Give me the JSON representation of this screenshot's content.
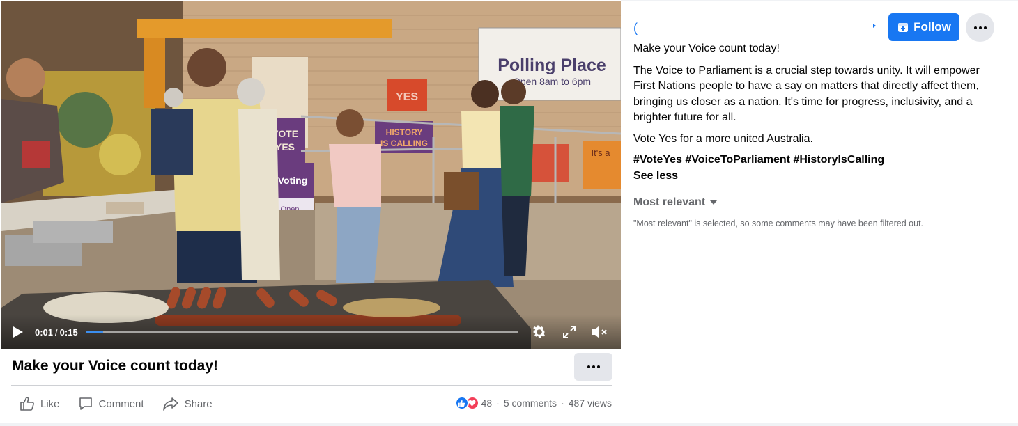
{
  "video": {
    "current_time": "0:01",
    "duration": "0:15",
    "time_separator": "/",
    "progress_fraction": 0.04,
    "scene_text": {
      "polling_title": "Polling Place",
      "polling_hours": "Open 8am to 6pm",
      "history_line1": "HISTORY",
      "history_line2": "IS CALLING",
      "yes_sign": "YES",
      "vote_sign_1": "VOTE",
      "vote_sign_2": "YES",
      "voting_sign": "Voting",
      "voting_open": "Open",
      "its_sign": "It's a"
    }
  },
  "post": {
    "title": "Make your Voice count today!",
    "actions": {
      "like": "Like",
      "comment": "Comment",
      "share": "Share"
    },
    "stats": {
      "reactions_count": "48",
      "separator": "·",
      "comments": "5 comments",
      "views": "487 views"
    }
  },
  "sidebar": {
    "follow_label": "Follow",
    "caption": {
      "headline": "Make your Voice count today!",
      "body": "The Voice to Parliament is a crucial step towards unity. It will empower First Nations people to have a say on matters that directly affect them, bringing us closer as a nation. It's time for progress, inclusivity, and a brighter future for all.",
      "cta": "Vote Yes for a more united Australia.",
      "hashtags": [
        "#VoteYes",
        "#VoiceToParliament",
        "#HistoryIsCalling"
      ],
      "see_less": "See less"
    },
    "comments_sort": "Most relevant",
    "filter_note": "\"Most relevant\" is selected, so some comments may have been filtered out."
  },
  "colors": {
    "accent": "#1877f2",
    "love": "#f33e58",
    "secondary_text": "#65676b",
    "button_gray": "#e4e6eb"
  },
  "icons": [
    "play-icon",
    "settings-icon",
    "fullscreen-icon",
    "muted-icon",
    "more-icon",
    "like-icon",
    "comment-icon",
    "share-icon",
    "follow-icon",
    "caret-down-icon"
  ]
}
